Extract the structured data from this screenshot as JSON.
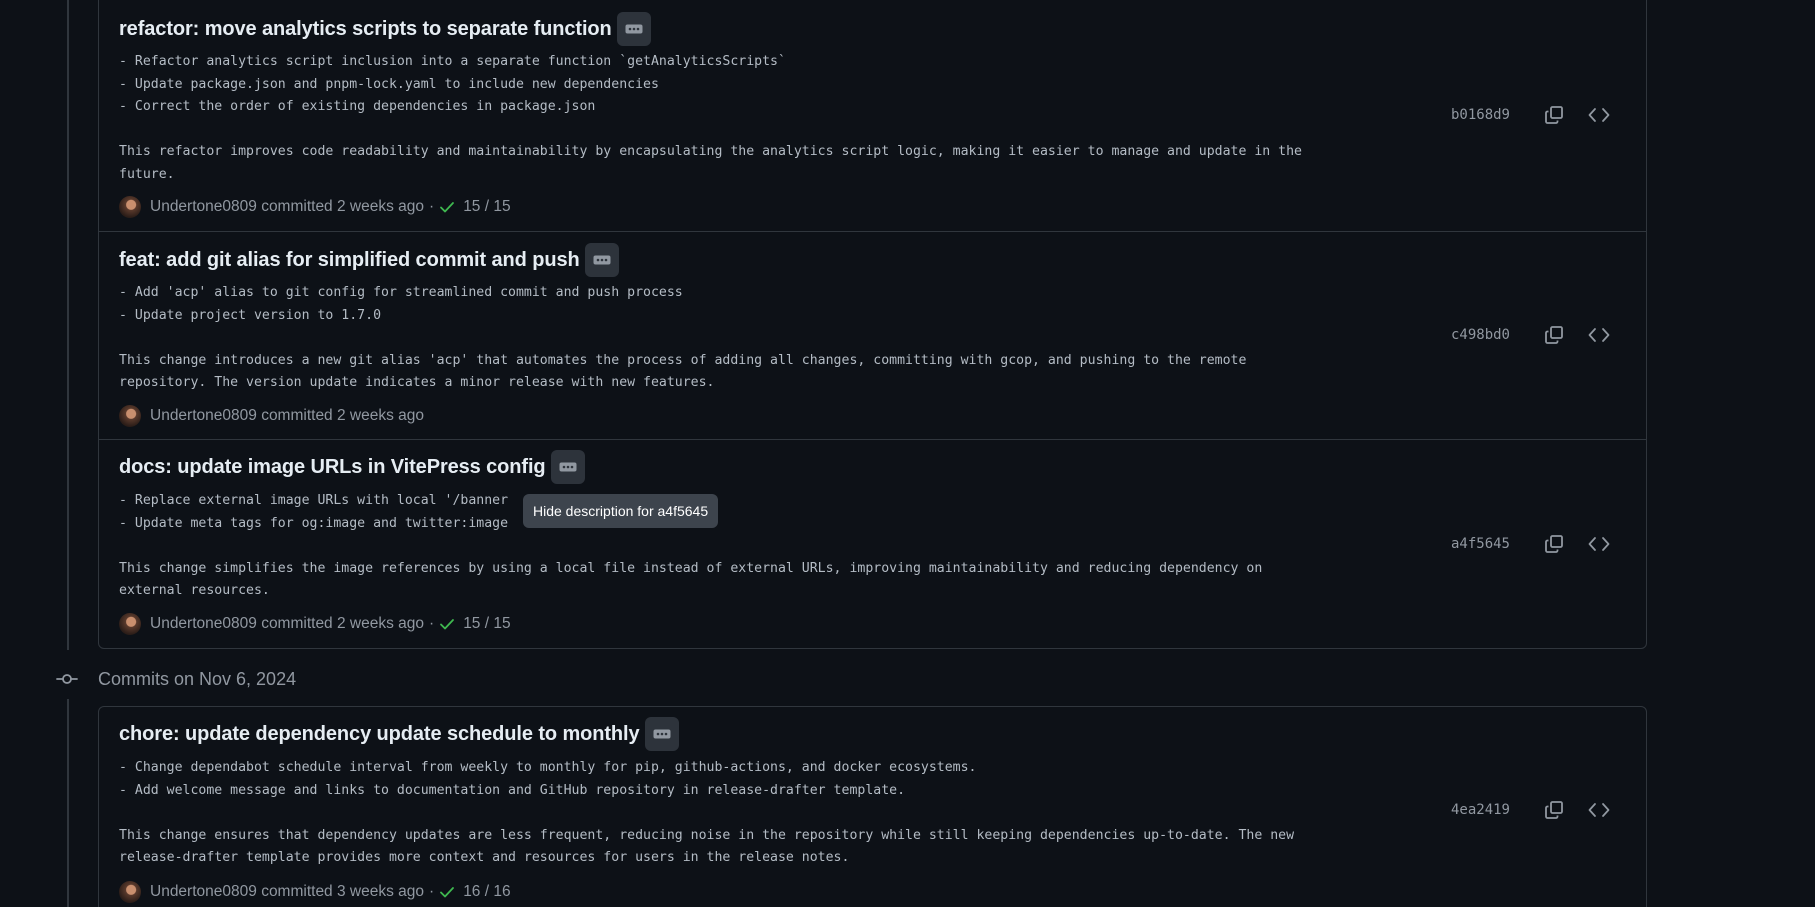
{
  "groups": [
    {
      "commits": [
        {
          "title": "refactor: move analytics scripts to separate function",
          "description": "- Refactor analytics script inclusion into a separate function `getAnalyticsScripts`\n- Update package.json and pnpm-lock.yaml to include new dependencies\n- Correct the order of existing dependencies in package.json\n\nThis refactor improves code readability and maintainability by encapsulating the analytics script logic, making it easier to manage and update in the\nfuture.",
          "author": "Undertone0809",
          "committed": "committed 2 weeks ago",
          "separator": "·",
          "checks": "15 / 15",
          "sha": "b0168d9"
        },
        {
          "title": "feat: add git alias for simplified commit and push",
          "description": "- Add 'acp' alias to git config for streamlined commit and push process\n- Update project version to 1.7.0\n\nThis change introduces a new git alias 'acp' that automates the process of adding all changes, committing with gcop, and pushing to the remote\nrepository. The version update indicates a minor release with new features.",
          "author": "Undertone0809",
          "committed": "committed 2 weeks ago",
          "separator": "",
          "checks": "",
          "sha": "c498bd0"
        },
        {
          "title": "docs: update image URLs in VitePress config",
          "description": "- Replace external image URLs with local '/banner\n- Update meta tags for og:image and twitter:image\n\nThis change simplifies the image references by using a local file instead of external URLs, improving maintainability and reducing dependency on\nexternal resources.",
          "author": "Undertone0809",
          "committed": "committed 2 weeks ago",
          "separator": "·",
          "checks": "15 / 15",
          "sha": "a4f5645"
        }
      ]
    },
    {
      "date_label": "Commits on Nov 6, 2024",
      "commits": [
        {
          "title": "chore: update dependency update schedule to monthly",
          "description": "- Change dependabot schedule interval from weekly to monthly for pip, github-actions, and docker ecosystems.\n- Add welcome message and links to documentation and GitHub repository in release-drafter template.\n\nThis change ensures that dependency updates are less frequent, reducing noise in the repository while still keeping dependencies up-to-date. The new\nrelease-drafter template provides more context and resources for users in the release notes.",
          "author": "Undertone0809",
          "committed": "committed 3 weeks ago",
          "separator": "·",
          "checks": "16 / 16",
          "sha": "4ea2419"
        }
      ]
    }
  ],
  "tooltip": "Hide description for a4f5645",
  "icons": {
    "ellipsis": "ellipsis-icon",
    "copy": "copy-icon",
    "browse": "code-icon",
    "check": "check-icon",
    "commit": "git-commit-icon"
  },
  "colors": {
    "background": "#0d1117",
    "border": "#30363d",
    "check": "#3fb950",
    "muted": "#9198a1"
  }
}
